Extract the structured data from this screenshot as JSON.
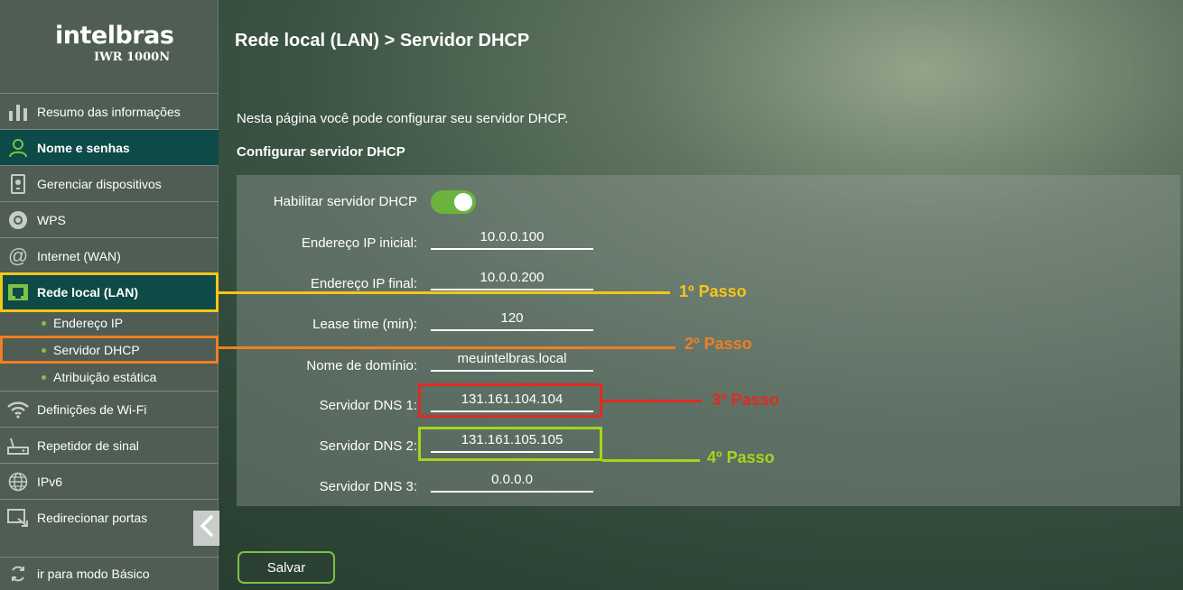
{
  "brand": {
    "name": "intelbras",
    "model": "IWR 1000N"
  },
  "sidebar": {
    "items": [
      {
        "label": "Resumo das informações",
        "icon": "bar-chart-icon"
      },
      {
        "label": "Nome e senhas",
        "icon": "user-icon"
      },
      {
        "label": "Gerenciar dispositivos",
        "icon": "device-icon"
      },
      {
        "label": "WPS",
        "icon": "wps-icon"
      },
      {
        "label": "Internet (WAN)",
        "icon": "at-sign-icon"
      },
      {
        "label": "Rede local (LAN)",
        "icon": "lan-port-icon"
      },
      {
        "label": "Definições de Wi-Fi",
        "icon": "wifi-icon"
      },
      {
        "label": "Repetidor de sinal",
        "icon": "router-icon"
      },
      {
        "label": "IPv6",
        "icon": "globe-icon"
      },
      {
        "label": "Redirecionar portas",
        "icon": "port-forward-icon"
      }
    ],
    "subitems": [
      "Endereço IP",
      "Servidor DHCP",
      "Atribuição estática"
    ],
    "mode_label": "ir para modo Básico"
  },
  "main": {
    "title": "Rede local (LAN) > Servidor DHCP",
    "intro": "Nesta página você pode configurar seu servidor DHCP.",
    "section_title": "Configurar servidor DHCP",
    "fields": {
      "enable_label": "Habilitar servidor DHCP",
      "start_ip_label": "Endereço IP inicial:",
      "start_ip": "10.0.0.100",
      "end_ip_label": "Endereço IP final:",
      "end_ip": "10.0.0.200",
      "lease_label": "Lease time (min):",
      "lease": "120",
      "domain_label": "Nome de domínio:",
      "domain": "meuintelbras.local",
      "dns1_label": "Servidor DNS 1:",
      "dns1": "131.161.104.104",
      "dns2_label": "Servidor DNS 2:",
      "dns2": "131.161.105.105",
      "dns3_label": "Servidor DNS 3:",
      "dns3": "0.0.0.0"
    },
    "save_label": "Salvar"
  },
  "annotations": {
    "step1": "1º Passo",
    "step2": "2º Passo",
    "step3": "3º Passo",
    "step4": "4º Passo",
    "colors": {
      "step1": "#f5c518",
      "step2": "#f07f22",
      "step3": "#e02b20",
      "step4": "#a6d41c"
    }
  },
  "colors": {
    "accent_green": "#7ec242",
    "active_nav": "#0e4a47"
  }
}
